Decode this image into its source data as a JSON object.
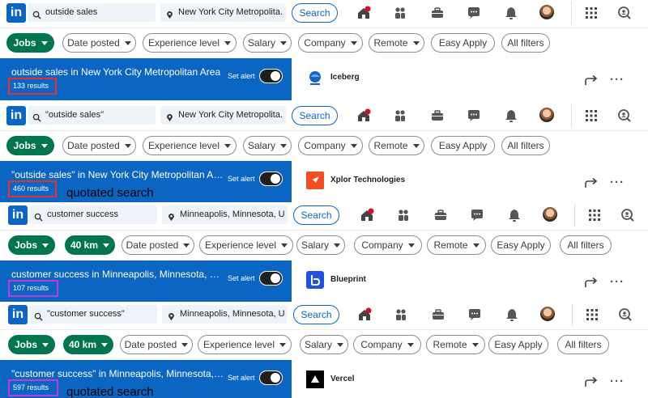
{
  "colors": {
    "linkedin_blue": "#0a66c2",
    "filter_green": "#01754f",
    "highlight_red": "#e0312b",
    "highlight_purple": "#c23bd4"
  },
  "screenshots": [
    {
      "logo": "in",
      "keyword": "outside sales",
      "location": "New York City Metropolita...",
      "search_label": "Search",
      "filters": [
        "Jobs",
        "Date posted",
        "Experience level",
        "Salary",
        "Company",
        "Remote",
        "Easy Apply",
        "All filters"
      ],
      "results_title": "outside sales in New York City Metropolitan Area",
      "results_count": "133 results",
      "set_alert": "Set alert",
      "annotation": "",
      "company": "Iceberg"
    },
    {
      "logo": "in",
      "keyword": "\"outside sales\"",
      "location": "New York City Metropolita...",
      "search_label": "Search",
      "filters": [
        "Jobs",
        "Date posted",
        "Experience level",
        "Salary",
        "Company",
        "Remote",
        "Easy Apply",
        "All filters"
      ],
      "results_title": "\"outside sales\" in New York City Metropolitan Area",
      "results_count": "460 results",
      "set_alert": "Set alert",
      "annotation": "quotated search",
      "company": "Xplor Technologies"
    },
    {
      "logo": "in",
      "keyword": "customer success",
      "location": "Minneapolis, Minnesota, U...",
      "search_label": "Search",
      "filters": [
        "Jobs",
        "40 km",
        "Date posted",
        "Experience level",
        "Salary",
        "Company",
        "Remote",
        "Easy Apply",
        "All filters"
      ],
      "results_title": "customer success in Minneapolis, Minnesota, Unit...",
      "results_count": "107 results",
      "set_alert": "Set alert",
      "annotation": "",
      "company": "Blueprint"
    },
    {
      "logo": "in",
      "keyword": "\"customer success\"",
      "location": "Minneapolis, Minnesota, U...",
      "search_label": "Search",
      "filters": [
        "Jobs",
        "40 km",
        "Date posted",
        "Experience level",
        "Salary",
        "Company",
        "Remote",
        "Easy Apply",
        "All filters"
      ],
      "results_title": "\"customer success\" in Minneapolis, Minnesota, U...",
      "results_count": "597 results",
      "set_alert": "Set alert",
      "annotation": "quotated search",
      "company": "Vercel"
    }
  ],
  "icons": {
    "search": "search-icon",
    "location": "location-pin-icon",
    "home": "home-icon",
    "network": "my-network-icon",
    "jobs": "briefcase-icon",
    "messaging": "messaging-icon",
    "notifications": "bell-icon",
    "apps": "grid-apps-icon",
    "hiring": "hiring-icon",
    "share": "share-icon",
    "more": "more-options-icon"
  }
}
